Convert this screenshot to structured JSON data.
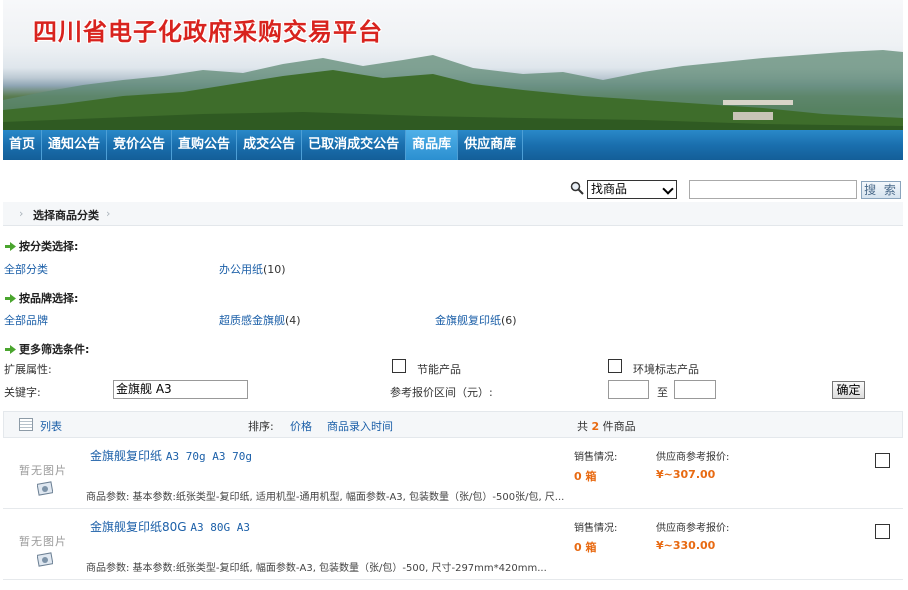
{
  "header": {
    "site_title": "四川省电子化政府采购交易平台"
  },
  "nav": {
    "items": [
      {
        "label": "首页"
      },
      {
        "label": "通知公告"
      },
      {
        "label": "竞价公告"
      },
      {
        "label": "直购公告"
      },
      {
        "label": "成交公告"
      },
      {
        "label": "已取消成交公告"
      },
      {
        "label": "商品库",
        "active": true
      },
      {
        "label": "供应商库"
      }
    ]
  },
  "search": {
    "type_selected": "找商品",
    "query_value": "",
    "button_label": "搜 索"
  },
  "breadcrumb": {
    "label": "选择商品分类"
  },
  "filters": {
    "category": {
      "heading": "按分类选择:",
      "all_label": "全部分类",
      "items": [
        {
          "label": "办公用纸",
          "count": "(10)"
        }
      ]
    },
    "brand": {
      "heading": "按品牌选择:",
      "all_label": "全部品牌",
      "items": [
        {
          "label": "超质感金旗舰",
          "count": "(4)"
        },
        {
          "label": "金旗舰复印纸",
          "count": "(6)"
        }
      ]
    },
    "more": {
      "heading": "更多筛选条件:",
      "ext_attr_label": "扩展属性:",
      "energy_label": "节能产品",
      "eco_label": "环境标志产品",
      "keyword_label": "关键字:",
      "keyword_value": "金旗舰 A3",
      "price_range_label": "参考报价区间（元）:",
      "price_min": "",
      "to_label": "至",
      "price_max": "",
      "confirm_label": "确定"
    }
  },
  "results": {
    "view_label": "列表",
    "sort_label": "排序:",
    "sort_price": "价格",
    "sort_time": "商品录入时间",
    "total_prefix": "共",
    "total_count": "2",
    "total_suffix": "件商品"
  },
  "products": [
    {
      "no_image_text": "暂无图片",
      "title": "金旗舰复印纸",
      "title_spec": "A3 70g A3 70g",
      "params": "商品参数:  基本参数:纸张类型-复印纸, 适用机型-通用机型, 幅面参数-A3, 包装数量（张/包）-500张/包, 尺...",
      "sales_label": "销售情况:",
      "sales_value": "0 箱",
      "price_label": "供应商参考报价:",
      "price_value": "¥~307.00"
    },
    {
      "no_image_text": "暂无图片",
      "title": "金旗舰复印纸80G",
      "title_spec": "A3 80G A3",
      "params": "商品参数:  基本参数:纸张类型-复印纸, 幅面参数-A3, 包装数量（张/包）-500, 尺寸-297mm*420mm...",
      "sales_label": "销售情况:",
      "sales_value": "0 箱",
      "price_label": "供应商参考报价:",
      "price_value": "¥~330.00"
    }
  ],
  "colors": {
    "nav_bg": "#1a6fae",
    "link": "#1b5fa8",
    "price": "#e86a12",
    "title_red": "#d8231e"
  }
}
